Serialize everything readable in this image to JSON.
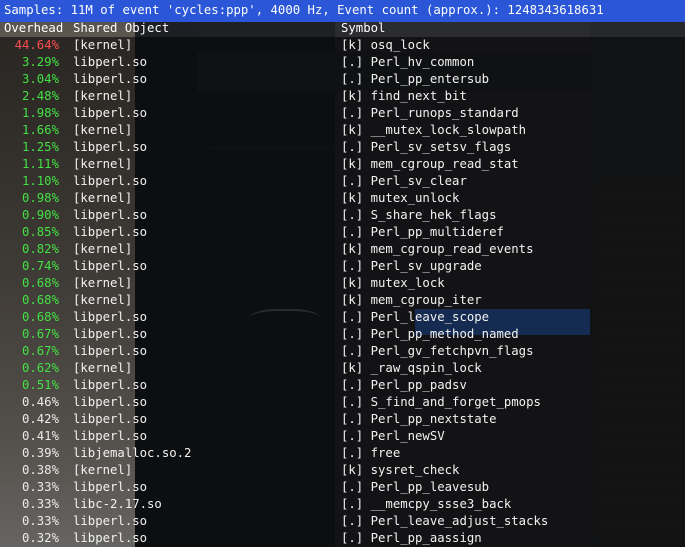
{
  "header": {
    "text": "Samples: 11M of event 'cycles:ppp', 4000 Hz, Event count (approx.): 1248343618631"
  },
  "columns": {
    "overhead": "Overhead",
    "shared_object": "Shared Object",
    "symbol": "Symbol"
  },
  "colors": {
    "header_bg": "#2a56d7",
    "high": "#ff4d4d",
    "medium": "#44e044",
    "low": "#eaeaea"
  },
  "rows": [
    {
      "overhead": "44.64%",
      "level": "high",
      "object": "[kernel]",
      "symbol": "[k] osq_lock"
    },
    {
      "overhead": "3.29%",
      "level": "medium",
      "object": "libperl.so",
      "symbol": "[.] Perl_hv_common"
    },
    {
      "overhead": "3.04%",
      "level": "medium",
      "object": "libperl.so",
      "symbol": "[.] Perl_pp_entersub"
    },
    {
      "overhead": "2.48%",
      "level": "medium",
      "object": "[kernel]",
      "symbol": "[k] find_next_bit"
    },
    {
      "overhead": "1.98%",
      "level": "medium",
      "object": "libperl.so",
      "symbol": "[.] Perl_runops_standard"
    },
    {
      "overhead": "1.66%",
      "level": "medium",
      "object": "[kernel]",
      "symbol": "[k] __mutex_lock_slowpath"
    },
    {
      "overhead": "1.25%",
      "level": "medium",
      "object": "libperl.so",
      "symbol": "[.] Perl_sv_setsv_flags"
    },
    {
      "overhead": "1.11%",
      "level": "medium",
      "object": "[kernel]",
      "symbol": "[k] mem_cgroup_read_stat"
    },
    {
      "overhead": "1.10%",
      "level": "medium",
      "object": "libperl.so",
      "symbol": "[.] Perl_sv_clear"
    },
    {
      "overhead": "0.98%",
      "level": "medium",
      "object": "[kernel]",
      "symbol": "[k] mutex_unlock"
    },
    {
      "overhead": "0.90%",
      "level": "medium",
      "object": "libperl.so",
      "symbol": "[.] S_share_hek_flags"
    },
    {
      "overhead": "0.85%",
      "level": "medium",
      "object": "libperl.so",
      "symbol": "[.] Perl_pp_multideref"
    },
    {
      "overhead": "0.82%",
      "level": "medium",
      "object": "[kernel]",
      "symbol": "[k] mem_cgroup_read_events"
    },
    {
      "overhead": "0.74%",
      "level": "medium",
      "object": "libperl.so",
      "symbol": "[.] Perl_sv_upgrade"
    },
    {
      "overhead": "0.68%",
      "level": "medium",
      "object": "[kernel]",
      "symbol": "[k] mutex_lock"
    },
    {
      "overhead": "0.68%",
      "level": "medium",
      "object": "[kernel]",
      "symbol": "[k] mem_cgroup_iter"
    },
    {
      "overhead": "0.68%",
      "level": "medium",
      "object": "libperl.so",
      "symbol": "[.] Perl_leave_scope"
    },
    {
      "overhead": "0.67%",
      "level": "medium",
      "object": "libperl.so",
      "symbol": "[.] Perl_pp_method_named"
    },
    {
      "overhead": "0.67%",
      "level": "medium",
      "object": "libperl.so",
      "symbol": "[.] Perl_gv_fetchpvn_flags"
    },
    {
      "overhead": "0.62%",
      "level": "medium",
      "object": "[kernel]",
      "symbol": "[k] _raw_qspin_lock"
    },
    {
      "overhead": "0.51%",
      "level": "medium",
      "object": "libperl.so",
      "symbol": "[.] Perl_pp_padsv"
    },
    {
      "overhead": "0.46%",
      "level": "low",
      "object": "libperl.so",
      "symbol": "[.] S_find_and_forget_pmops"
    },
    {
      "overhead": "0.42%",
      "level": "low",
      "object": "libperl.so",
      "symbol": "[.] Perl_pp_nextstate"
    },
    {
      "overhead": "0.41%",
      "level": "low",
      "object": "libperl.so",
      "symbol": "[.] Perl_newSV"
    },
    {
      "overhead": "0.39%",
      "level": "low",
      "object": "libjemalloc.so.2",
      "symbol": "[.] free"
    },
    {
      "overhead": "0.38%",
      "level": "low",
      "object": "[kernel]",
      "symbol": "[k] sysret_check"
    },
    {
      "overhead": "0.33%",
      "level": "low",
      "object": "libperl.so",
      "symbol": "[.] Perl_pp_leavesub"
    },
    {
      "overhead": "0.33%",
      "level": "low",
      "object": "libc-2.17.so",
      "symbol": "[.] __memcpy_ssse3_back"
    },
    {
      "overhead": "0.33%",
      "level": "low",
      "object": "libperl.so",
      "symbol": "[.] Perl_leave_adjust_stacks"
    },
    {
      "overhead": "0.32%",
      "level": "low",
      "object": "libperl.so",
      "symbol": "[.] Perl_pp_aassign"
    }
  ]
}
